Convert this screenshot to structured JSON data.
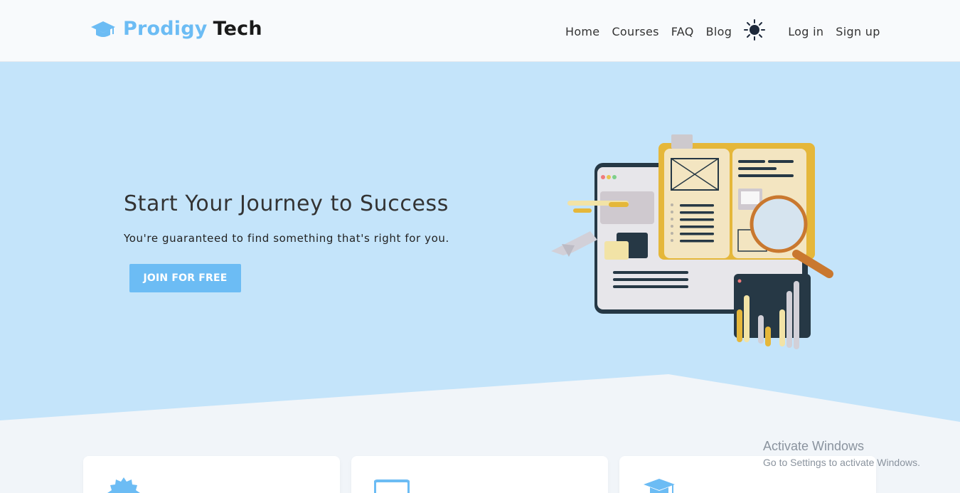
{
  "header": {
    "logo_primary": "Prodigy",
    "logo_secondary": "Tech",
    "nav": {
      "home": "Home",
      "courses": "Courses",
      "faq": "FAQ",
      "blog": "Blog",
      "login": "Log in",
      "signup": "Sign up"
    },
    "theme_icon": "sun-icon"
  },
  "hero": {
    "title": "Start Your Journey to Success",
    "subtitle": "You're guaranteed to find something that's right for you.",
    "cta": "JOIN FOR FREE"
  },
  "cards": [
    {
      "icon": "badge-icon"
    },
    {
      "icon": "monitor-icon"
    },
    {
      "icon": "graduation-cap-icon"
    }
  ],
  "watermark": {
    "title": "Activate Windows",
    "subtitle": "Go to Settings to activate Windows."
  },
  "colors": {
    "accent": "#6cbcf4",
    "hero_bg": "#c4e4fa",
    "page_bg": "#f1f5f9"
  }
}
